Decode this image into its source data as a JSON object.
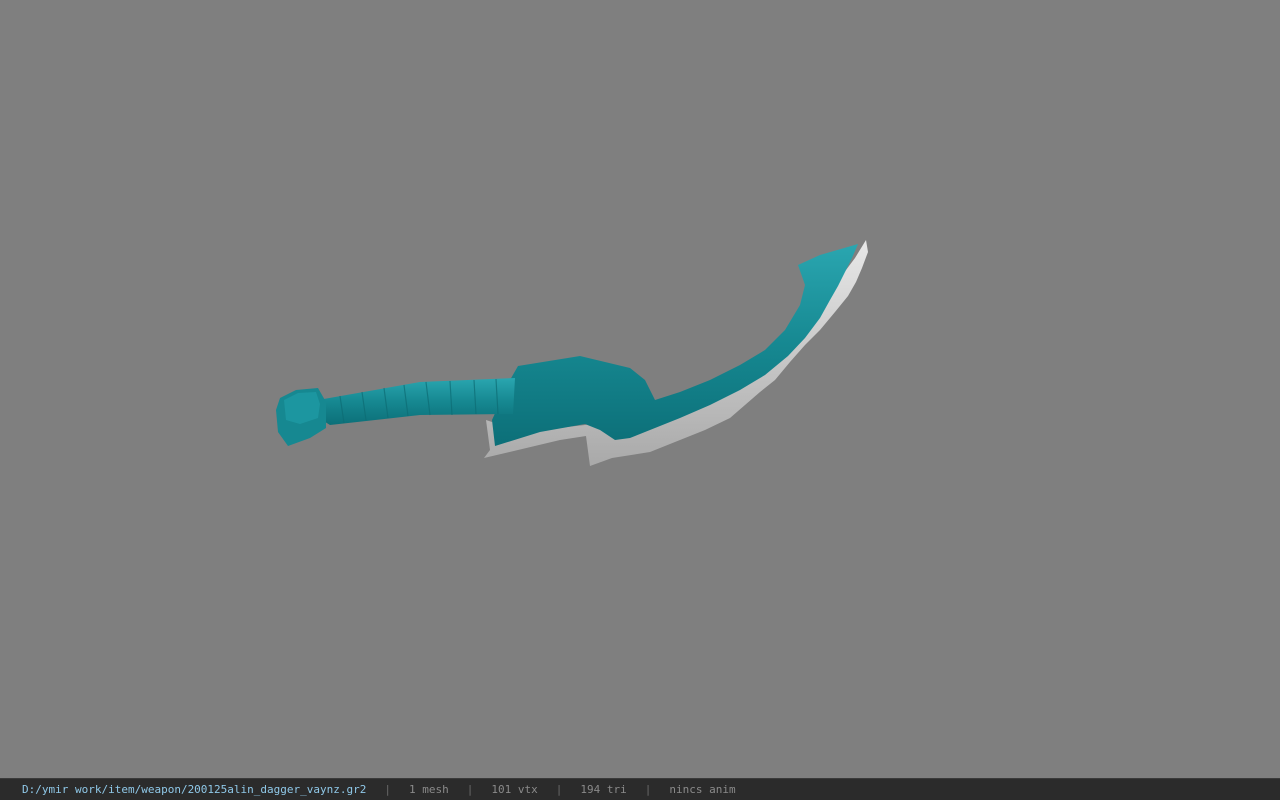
{
  "viewport": {
    "background_color": "#7f7f7f",
    "model": {
      "name": "dagger-model",
      "handle_color": "#1a8c96",
      "blade_edge_color": "#cfcfcf"
    }
  },
  "statusbar": {
    "path": "D:/ymir work/item/weapon/200125alin_dagger_vaynz.gr2",
    "separator": "|",
    "mesh": "1 mesh",
    "vtx": "101 vtx",
    "tri": "194 tri",
    "anim": "nincs anim"
  }
}
